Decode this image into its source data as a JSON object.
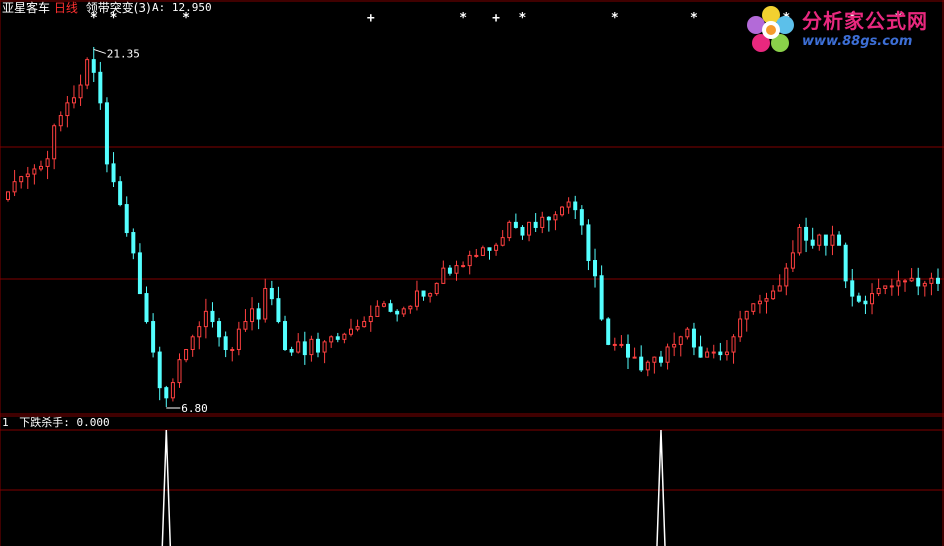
{
  "header": {
    "stock_name": "亚星客车",
    "period": "日线",
    "indicator": "领带突变(3)",
    "a_label": "A: 12.950"
  },
  "price_markers": {
    "high": "21.35",
    "low": "6.80"
  },
  "sub_panel": {
    "index": "1",
    "indicator_value": "下跌杀手: 0.000"
  },
  "logo": {
    "title": "分析家公式网",
    "url": "www.88gs.com"
  },
  "colors": {
    "up": "#ff4040",
    "down": "#54ffff",
    "grid": "#800000",
    "text": "#ffffff",
    "period": "#ff3030"
  },
  "chart_data": {
    "type": "candlestick",
    "price_range": [
      6.8,
      21.35
    ],
    "open": [
      15.0,
      15.3,
      15.7,
      15.9,
      16.0,
      16.2,
      16.3,
      16.6,
      17.9,
      18.3,
      18.8,
      19.0,
      19.5,
      20.5,
      20.0,
      18.8,
      16.4,
      15.7,
      14.8,
      13.7,
      12.9,
      11.3,
      10.2,
      9.0,
      7.6,
      7.2,
      7.8,
      8.7,
      9.1,
      9.6,
      10.0,
      10.6,
      10.2,
      9.6,
      9.1,
      9.1,
      9.9,
      10.2,
      10.7,
      10.3,
      11.5,
      11.1,
      10.2,
      9.1,
      9.0,
      9.4,
      8.9,
      9.5,
      9.0,
      9.4,
      9.6,
      9.5,
      9.7,
      9.9,
      10.0,
      10.2,
      10.4,
      10.8,
      10.9,
      10.6,
      10.5,
      10.7,
      10.8,
      11.4,
      11.2,
      11.3,
      11.7,
      12.3,
      12.1,
      12.4,
      12.4,
      12.8,
      12.8,
      13.1,
      13.0,
      13.2,
      13.5,
      14.1,
      13.9,
      13.6,
      14.1,
      13.9,
      14.3,
      14.2,
      14.4,
      14.7,
      14.9,
      14.6,
      14.0,
      12.6,
      12.0,
      10.3,
      9.3,
      9.3,
      9.3,
      8.8,
      8.8,
      8.3,
      8.6,
      8.8,
      8.6,
      9.2,
      9.3,
      9.6,
      9.9,
      9.2,
      8.8,
      9.0,
      9.0,
      8.9,
      9.0,
      9.6,
      10.3,
      10.6,
      10.9,
      11.0,
      11.1,
      11.4,
      11.6,
      12.3,
      12.9,
      13.9,
      13.4,
      13.2,
      13.6,
      13.2,
      13.6,
      13.2,
      11.8,
      11.2,
      11.0,
      10.9,
      11.3,
      11.5,
      11.6,
      11.6,
      11.8,
      11.8,
      11.9,
      11.6,
      11.7,
      11.9
    ],
    "close": [
      15.3,
      15.7,
      15.9,
      16.0,
      16.2,
      16.3,
      16.6,
      17.9,
      18.3,
      18.8,
      19.0,
      19.5,
      20.5,
      20.0,
      18.8,
      16.4,
      15.7,
      14.8,
      13.7,
      12.9,
      11.3,
      10.2,
      9.0,
      7.6,
      7.2,
      7.8,
      8.7,
      9.1,
      9.6,
      10.0,
      10.6,
      10.2,
      9.6,
      9.1,
      9.1,
      9.9,
      10.2,
      10.7,
      10.3,
      11.5,
      11.1,
      10.2,
      9.1,
      9.0,
      9.4,
      8.9,
      9.5,
      9.0,
      9.4,
      9.6,
      9.5,
      9.7,
      9.9,
      10.0,
      10.2,
      10.4,
      10.8,
      10.9,
      10.6,
      10.5,
      10.7,
      10.8,
      11.4,
      11.2,
      11.3,
      11.7,
      12.3,
      12.1,
      12.4,
      12.4,
      12.8,
      12.8,
      13.1,
      13.0,
      13.2,
      13.5,
      14.1,
      13.9,
      13.6,
      14.1,
      13.9,
      14.3,
      14.2,
      14.4,
      14.7,
      14.9,
      14.6,
      14.0,
      12.6,
      12.0,
      10.3,
      9.3,
      9.3,
      9.3,
      8.8,
      8.8,
      8.3,
      8.6,
      8.8,
      8.6,
      9.2,
      9.3,
      9.6,
      9.9,
      9.2,
      8.8,
      9.0,
      9.0,
      8.9,
      9.0,
      9.6,
      10.3,
      10.6,
      10.9,
      11.0,
      11.1,
      11.4,
      11.6,
      12.3,
      12.9,
      13.9,
      13.4,
      13.2,
      13.6,
      13.2,
      13.6,
      13.2,
      11.8,
      11.2,
      11.0,
      10.9,
      11.3,
      11.5,
      11.6,
      11.6,
      11.8,
      11.8,
      11.9,
      11.6,
      11.7,
      11.9,
      11.7
    ],
    "marker_index_high": 13,
    "marker_index_low": 24,
    "signals": [
      {
        "index": 13,
        "symbol": "*"
      },
      {
        "index": 16,
        "symbol": "*"
      },
      {
        "index": 27,
        "symbol": "*"
      },
      {
        "index": 55,
        "symbol": "+"
      },
      {
        "index": 69,
        "symbol": "*"
      },
      {
        "index": 74,
        "symbol": "+"
      },
      {
        "index": 78,
        "symbol": "*"
      },
      {
        "index": 92,
        "symbol": "*"
      },
      {
        "index": 104,
        "symbol": "*"
      },
      {
        "index": 116,
        "symbol": "*"
      },
      {
        "index": 118,
        "symbol": "*"
      },
      {
        "index": 128,
        "symbol": "*"
      },
      {
        "index": 135,
        "symbol": "*"
      }
    ],
    "sub_spikes": [
      24,
      99
    ]
  }
}
